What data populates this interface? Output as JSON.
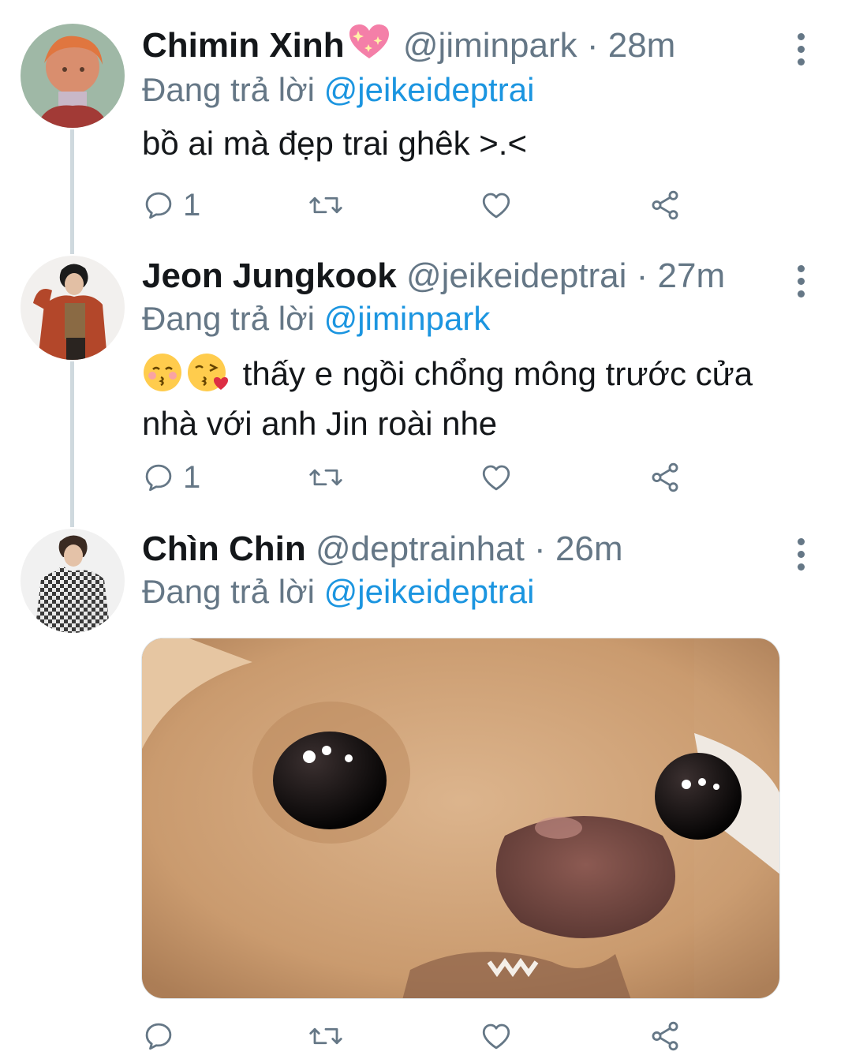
{
  "thread": [
    {
      "name": "Chimin Xinh",
      "handle": "@jiminpark",
      "time": "28m",
      "reply_prefix": "Đang trả lời",
      "reply_to": "@jeikeideptrai",
      "text": "bồ ai mà đẹp trai ghêk >.<",
      "reply_count": "1"
    },
    {
      "name": "Jeon Jungkook",
      "handle": "@jeikeideptrai",
      "time": "27m",
      "reply_prefix": "Đang trả lời",
      "reply_to": "@jiminpark",
      "text_line1": "thấy e ngồi chổng mông trước cửa",
      "text_line2": "nhà với anh Jin roài nhe",
      "reply_count": "1"
    },
    {
      "name": "Chìn Chin",
      "handle": "@deptrainhat",
      "time": "26m",
      "reply_prefix": "Đang trả lời",
      "reply_to": "@jeikeideptrai",
      "reply_count": ""
    }
  ],
  "separator": "·",
  "icons": [
    "reply-icon",
    "retweet-icon",
    "like-icon",
    "share-icon",
    "more-icon",
    "sparkling-heart-emoji",
    "kissing-face-emoji",
    "face-blowing-kiss-emoji"
  ],
  "colors": {
    "link": "#1b95e0",
    "secondary": "#657786",
    "thread_line": "#cfd9de"
  }
}
